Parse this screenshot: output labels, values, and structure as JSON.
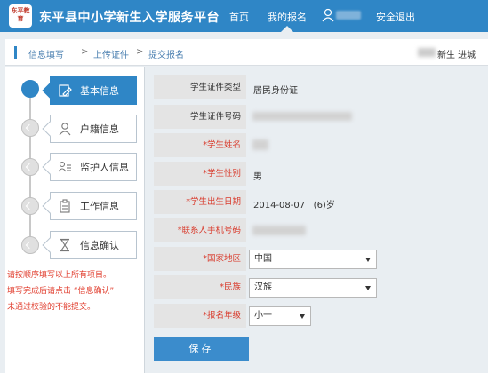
{
  "header": {
    "logo_text": "东平教育",
    "site_title": "东平县中小学新生入学服务平台",
    "nav": [
      "首页",
      "我的报名",
      "安全退出"
    ]
  },
  "breadcrumb": {
    "items": [
      "信息填写",
      "上传证件",
      "提交报名"
    ],
    "separator": ">",
    "right_text": "新生 进城"
  },
  "steps": [
    {
      "label": "基本信息",
      "icon": "document-edit-icon",
      "active": true
    },
    {
      "label": "户籍信息",
      "icon": "person-icon",
      "active": false
    },
    {
      "label": "监护人信息",
      "icon": "guardian-card-icon",
      "active": false
    },
    {
      "label": "工作信息",
      "icon": "clipboard-icon",
      "active": false
    },
    {
      "label": "信息确认",
      "icon": "hourglass-icon",
      "active": false
    }
  ],
  "notes": [
    "请按顺序填写以上所有项目。",
    "填写完成后请点击 “信息确认”",
    "未通过校验的不能提交。"
  ],
  "form": {
    "id_type_label": "学生证件类型",
    "id_type_value": "居民身份证",
    "id_number_label": "学生证件号码",
    "required_mark": "*",
    "name_label": "学生姓名",
    "gender_label": "学生性别",
    "gender_value": "男",
    "birth_label": "学生出生日期",
    "birth_value": "2014-08-07",
    "age_value": "(6)岁",
    "phone_label": "联系人手机号码",
    "region_label": "国家地区",
    "region_value": "中国",
    "ethnicity_label": "民族",
    "ethnicity_value": "汉族",
    "grade_label": "报名年级",
    "grade_value": "小一"
  },
  "submit_label": "保存",
  "colors": {
    "primary": "#2f86c6",
    "required": "#d93a2b",
    "note": "#e03a2a"
  }
}
